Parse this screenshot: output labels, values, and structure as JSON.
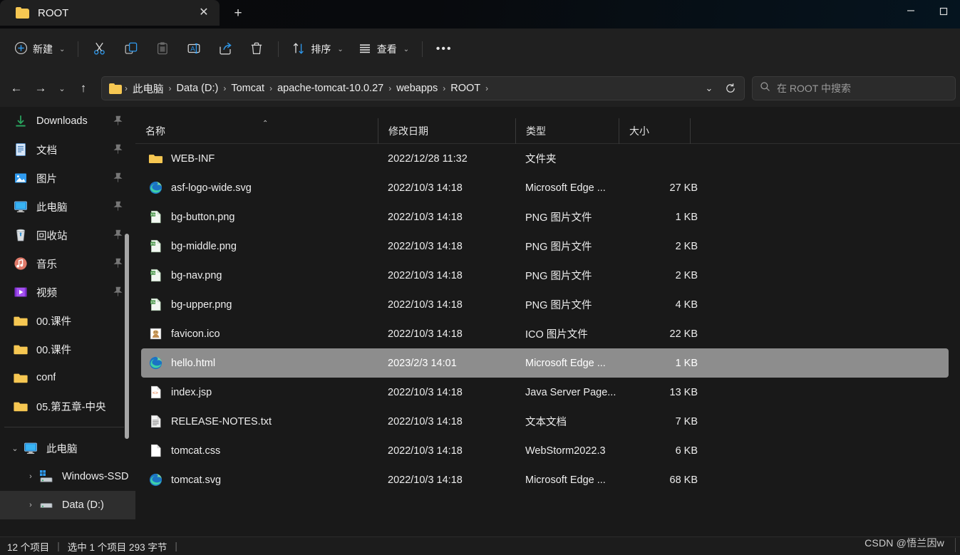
{
  "window": {
    "tab_title": "ROOT",
    "close_label": "✕",
    "newtab_label": "+",
    "minimize_label": "—",
    "maximize_label": "□"
  },
  "toolbar": {
    "new_label": "新建",
    "cut_label": "剪切",
    "copy_label": "复制",
    "paste_label": "粘贴",
    "rename_label": "重命名",
    "share_label": "共享",
    "delete_label": "删除",
    "sort_label": "排序",
    "view_label": "查看",
    "more_label": "•••",
    "chevron": "⌄"
  },
  "address": {
    "back": "←",
    "forward": "→",
    "recent": "⌄",
    "up": "↑",
    "crumbs": [
      "此电脑",
      "Data (D:)",
      "Tomcat",
      "apache-tomcat-10.0.27",
      "webapps",
      "ROOT"
    ],
    "separator": "›",
    "dropdown": "⌄",
    "refresh": "⟳",
    "search_placeholder": "在 ROOT 中搜索"
  },
  "sidebar": {
    "quick_items": [
      {
        "label": "Downloads",
        "icon": "download-icon",
        "pinned": true
      },
      {
        "label": "文档",
        "icon": "documents-icon",
        "pinned": true
      },
      {
        "label": "图片",
        "icon": "pictures-icon",
        "pinned": true
      },
      {
        "label": "此电脑",
        "icon": "this-pc-icon",
        "pinned": true
      },
      {
        "label": "回收站",
        "icon": "recycle-bin-icon",
        "pinned": true
      },
      {
        "label": "音乐",
        "icon": "music-icon",
        "pinned": true
      },
      {
        "label": "视频",
        "icon": "video-icon",
        "pinned": true
      },
      {
        "label": "00.课件",
        "icon": "folder-icon",
        "pinned": false
      },
      {
        "label": "00.课件",
        "icon": "folder-icon",
        "pinned": false
      },
      {
        "label": "conf",
        "icon": "folder-icon",
        "pinned": false
      },
      {
        "label": "05.第五章-中央",
        "icon": "folder-icon",
        "pinned": false
      }
    ],
    "tree": [
      {
        "label": "此电脑",
        "icon": "this-pc-icon",
        "expander": "⌄",
        "selected": false,
        "level": 0
      },
      {
        "label": "Windows-SSD",
        "icon": "windows-drive-icon",
        "expander": "›",
        "selected": false,
        "level": 1
      },
      {
        "label": "Data (D:)",
        "icon": "drive-icon",
        "expander": "›",
        "selected": true,
        "level": 1
      }
    ]
  },
  "filelist": {
    "columns": {
      "name": "名称",
      "date": "修改日期",
      "type": "类型",
      "size": "大小"
    },
    "sort_caret": "⌃",
    "rows": [
      {
        "name": "WEB-INF",
        "date": "2022/12/28 11:32",
        "type": "文件夹",
        "size": "",
        "icon": "folder-icon",
        "selected": false
      },
      {
        "name": "asf-logo-wide.svg",
        "date": "2022/10/3 14:18",
        "type": "Microsoft Edge ...",
        "size": "27 KB",
        "icon": "edge-icon",
        "selected": false
      },
      {
        "name": "bg-button.png",
        "date": "2022/10/3 14:18",
        "type": "PNG 图片文件",
        "size": "1 KB",
        "icon": "png-icon",
        "selected": false
      },
      {
        "name": "bg-middle.png",
        "date": "2022/10/3 14:18",
        "type": "PNG 图片文件",
        "size": "2 KB",
        "icon": "png-icon",
        "selected": false
      },
      {
        "name": "bg-nav.png",
        "date": "2022/10/3 14:18",
        "type": "PNG 图片文件",
        "size": "2 KB",
        "icon": "png-icon",
        "selected": false
      },
      {
        "name": "bg-upper.png",
        "date": "2022/10/3 14:18",
        "type": "PNG 图片文件",
        "size": "4 KB",
        "icon": "png-icon",
        "selected": false
      },
      {
        "name": "favicon.ico",
        "date": "2022/10/3 14:18",
        "type": "ICO 图片文件",
        "size": "22 KB",
        "icon": "ico-icon",
        "selected": false
      },
      {
        "name": "hello.html",
        "date": "2023/2/3 14:01",
        "type": "Microsoft Edge ...",
        "size": "1 KB",
        "icon": "edge-icon",
        "selected": true
      },
      {
        "name": "index.jsp",
        "date": "2022/10/3 14:18",
        "type": "Java Server Page...",
        "size": "13 KB",
        "icon": "jsp-icon",
        "selected": false
      },
      {
        "name": "RELEASE-NOTES.txt",
        "date": "2022/10/3 14:18",
        "type": "文本文档",
        "size": "7 KB",
        "icon": "text-icon",
        "selected": false
      },
      {
        "name": "tomcat.css",
        "date": "2022/10/3 14:18",
        "type": "WebStorm2022.3",
        "size": "6 KB",
        "icon": "blank-icon",
        "selected": false
      },
      {
        "name": "tomcat.svg",
        "date": "2022/10/3 14:18",
        "type": "Microsoft Edge ...",
        "size": "68 KB",
        "icon": "edge-icon",
        "selected": false
      }
    ]
  },
  "status": {
    "item_count": "12 个项目",
    "sep": "|",
    "selection": "选中 1 个项目  293 字节",
    "sep2": "|",
    "watermark": "CSDN @悟兰因w"
  },
  "colors": {
    "accent": "#2f9bf0",
    "folder": "#f6c752",
    "selection": "#8d8d8d",
    "chrome": "#202020",
    "pane": "#191919"
  }
}
